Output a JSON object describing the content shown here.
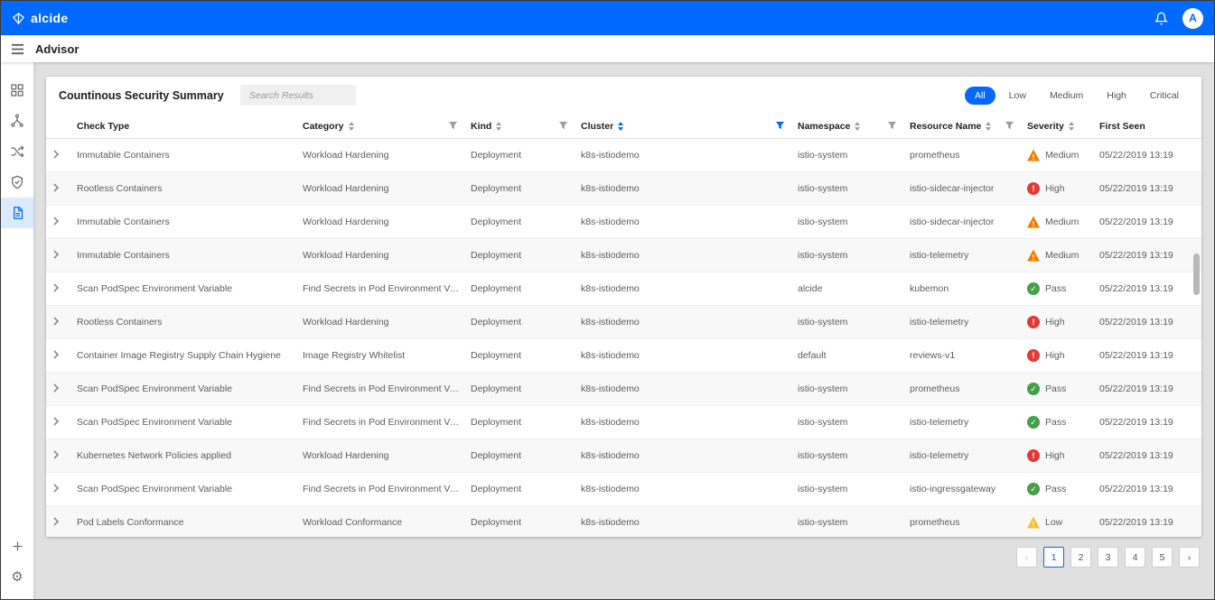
{
  "topbar": {
    "brand": "alcide",
    "icons": [
      "alcide-logo-icon",
      "bell-icon"
    ],
    "avatar_initial": "A"
  },
  "page": {
    "title": "Advisor"
  },
  "sidebar": {
    "icons": [
      "hamburger-menu-icon",
      "dashboard-grid-icon",
      "network-hierarchy-icon",
      "shuffle-arrows-icon",
      "shield-check-icon",
      "report-document-icon",
      "plus-icon",
      "gear-icon"
    ],
    "active_icon": "report-document-icon"
  },
  "card": {
    "title": "Countinous Security Summary",
    "search_placeholder": "Search Results",
    "filters": [
      "All",
      "Low",
      "Medium",
      "High",
      "Critical"
    ],
    "active_filter": "All"
  },
  "table": {
    "columns": [
      {
        "label": "Check Type",
        "sort": false,
        "filter": false
      },
      {
        "label": "Category",
        "sort": true,
        "filter": true
      },
      {
        "label": "Kind",
        "sort": true,
        "filter": true
      },
      {
        "label": "Cluster",
        "sort": true,
        "sort_active": true,
        "filter": true,
        "filter_active": true
      },
      {
        "label": "Namespace",
        "sort": true,
        "filter": true
      },
      {
        "label": "Resource Name",
        "sort": true,
        "filter": true
      },
      {
        "label": "Severity",
        "sort": true,
        "filter": false
      },
      {
        "label": "First Seen",
        "sort": false,
        "filter": false
      }
    ],
    "rows": [
      {
        "check_type": "Immutable Containers",
        "category": "Workload Hardening",
        "kind": "Deployment",
        "cluster": "k8s-istiodemo",
        "namespace": "istio-system",
        "resource_name": "prometheus",
        "severity": {
          "level": "medium",
          "label": "Medium"
        },
        "first_seen": "05/22/2019 13:19"
      },
      {
        "check_type": "Rootless Containers",
        "category": "Workload Hardening",
        "kind": "Deployment",
        "cluster": "k8s-istiodemo",
        "namespace": "istio-system",
        "resource_name": "istio-sidecar-injector",
        "severity": {
          "level": "high",
          "label": "High"
        },
        "first_seen": "05/22/2019 13:19"
      },
      {
        "check_type": "Immutable Containers",
        "category": "Workload Hardening",
        "kind": "Deployment",
        "cluster": "k8s-istiodemo",
        "namespace": "istio-system",
        "resource_name": "istio-sidecar-injector",
        "severity": {
          "level": "medium",
          "label": "Medium"
        },
        "first_seen": "05/22/2019 13:19"
      },
      {
        "check_type": "Immutable Containers",
        "category": "Workload Hardening",
        "kind": "Deployment",
        "cluster": "k8s-istiodemo",
        "namespace": "istio-system",
        "resource_name": "istio-telemetry",
        "severity": {
          "level": "medium",
          "label": "Medium"
        },
        "first_seen": "05/22/2019 13:19"
      },
      {
        "check_type": "Scan PodSpec Environment Variable",
        "category": "Find Secrets in Pod Environment Variables",
        "kind": "Deployment",
        "cluster": "k8s-istiodemo",
        "namespace": "alcide",
        "resource_name": "kubemon",
        "severity": {
          "level": "pass",
          "label": "Pass"
        },
        "first_seen": "05/22/2019 13:19"
      },
      {
        "check_type": "Rootless Containers",
        "category": "Workload Hardening",
        "kind": "Deployment",
        "cluster": "k8s-istiodemo",
        "namespace": "istio-system",
        "resource_name": "istio-telemetry",
        "severity": {
          "level": "high",
          "label": "High"
        },
        "first_seen": "05/22/2019 13:19"
      },
      {
        "check_type": "Container Image Registry Supply Chain Hygiene",
        "category": "Image Registry Whitelist",
        "kind": "Deployment",
        "cluster": "k8s-istiodemo",
        "namespace": "default",
        "resource_name": "reviews-v1",
        "severity": {
          "level": "high",
          "label": "High"
        },
        "first_seen": "05/22/2019 13:19"
      },
      {
        "check_type": "Scan PodSpec Environment Variable",
        "category": "Find Secrets in Pod Environment Variables",
        "kind": "Deployment",
        "cluster": "k8s-istiodemo",
        "namespace": "istio-system",
        "resource_name": "prometheus",
        "severity": {
          "level": "pass",
          "label": "Pass"
        },
        "first_seen": "05/22/2019 13:19"
      },
      {
        "check_type": "Scan PodSpec Environment Variable",
        "category": "Find Secrets in Pod Environment Variables",
        "kind": "Deployment",
        "cluster": "k8s-istiodemo",
        "namespace": "istio-system",
        "resource_name": "istio-telemetry",
        "severity": {
          "level": "pass",
          "label": "Pass"
        },
        "first_seen": "05/22/2019 13:19"
      },
      {
        "check_type": "Kubernetes Network Policies applied",
        "category": "Workload Hardening",
        "kind": "Deployment",
        "cluster": "k8s-istiodemo",
        "namespace": "istio-system",
        "resource_name": "istio-telemetry",
        "severity": {
          "level": "high",
          "label": "High"
        },
        "first_seen": "05/22/2019 13:19"
      },
      {
        "check_type": "Scan PodSpec Environment Variable",
        "category": "Find Secrets in Pod Environment Variables",
        "kind": "Deployment",
        "cluster": "k8s-istiodemo",
        "namespace": "istio-system",
        "resource_name": "istio-ingressgateway",
        "severity": {
          "level": "pass",
          "label": "Pass"
        },
        "first_seen": "05/22/2019 13:19"
      },
      {
        "check_type": "Pod Labels Conformance",
        "category": "Workload Conformance",
        "kind": "Deployment",
        "cluster": "k8s-istiodemo",
        "namespace": "istio-system",
        "resource_name": "prometheus",
        "severity": {
          "level": "low",
          "label": "Low"
        },
        "first_seen": "05/22/2019 13:19"
      }
    ]
  },
  "pagination": {
    "prev": "‹",
    "next": "›",
    "pages": [
      "1",
      "2",
      "3",
      "4",
      "5"
    ],
    "active_page": "1"
  },
  "colors": {
    "topbar": "#0069ff",
    "accent": "#0069ff",
    "severity": {
      "medium": "#f57c00",
      "high": "#e53935",
      "pass": "#43a047",
      "low": "#fbc02d"
    }
  }
}
